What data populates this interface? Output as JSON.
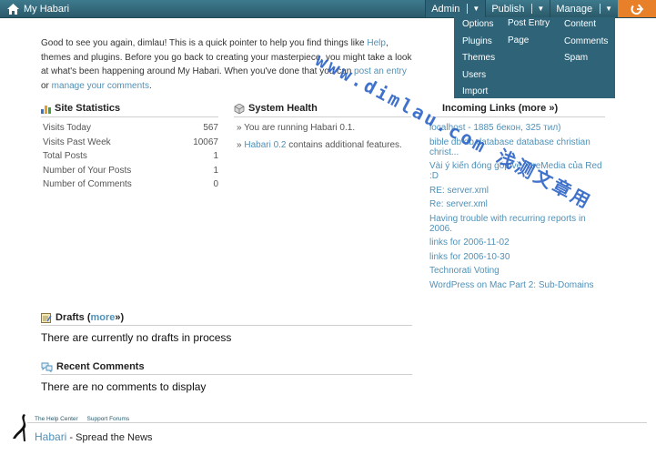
{
  "header": {
    "title": "My Habari",
    "menus": [
      {
        "label": "Admin"
      },
      {
        "label": "Publish"
      },
      {
        "label": "Manage"
      }
    ],
    "arrow": "▼"
  },
  "dropdown": {
    "admin": [
      "Options",
      "Plugins",
      "Themes",
      "Users",
      "Import"
    ],
    "publish": [
      "Post Entry",
      "Page"
    ],
    "manage": [
      "Content",
      "Comments",
      "Spam"
    ]
  },
  "watermark": "www.dimlau.com 浅测文章用",
  "intro": {
    "p1": "Good to see you again, dimlau! This is a quick pointer to help you find things like ",
    "help": "Help",
    "p2": ", themes and plugins. Before you go back to creating your masterpiece, you might take a look at what's been happening around My Habari. When you've done that you can ",
    "post_link": "post an entry",
    "p3": " or ",
    "manage_link": "manage your comments",
    "p4": "."
  },
  "site_statistics": {
    "title": "Site Statistics",
    "rows": [
      {
        "label": "Visits Today",
        "value": "567"
      },
      {
        "label": "Visits Past Week",
        "value": "10067"
      },
      {
        "label": "Total Posts",
        "value": "1"
      },
      {
        "label": "Number of Your Posts",
        "value": "1"
      },
      {
        "label": "Number of Comments",
        "value": "0"
      }
    ]
  },
  "system_health": {
    "title": "System Health",
    "bullet": "»",
    "line1": "You are running Habari 0.1.",
    "line2_link": "Habari 0.2",
    "line2_text": " contains additional features."
  },
  "incoming_links": {
    "title": "Incoming Links (more »)",
    "items": [
      "localhost - 1885 бекон, 325 тил)",
      "bible db db database database christian christ...",
      "Vài ý kiến đóng góp về XtreMedia của Red :D",
      "RE: server.xml",
      "Re: server.xml",
      "Having trouble with recurring reports in 2006.",
      "links for 2006-11-02",
      "links for 2006-10-30",
      "Technorati Voting",
      "WordPress on Mac Part 2: Sub-Domains"
    ]
  },
  "drafts": {
    "title_prefix": "Drafts (",
    "more": "more",
    "title_suffix": " »)",
    "empty": "There are currently no drafts in process"
  },
  "recent_comments": {
    "title": "Recent Comments",
    "empty": "There are no comments to display"
  },
  "footer": {
    "help_center": "The Help Center",
    "support_forums": "Support Forums",
    "brand": "Habari",
    "tagline": " - Spread the News"
  }
}
